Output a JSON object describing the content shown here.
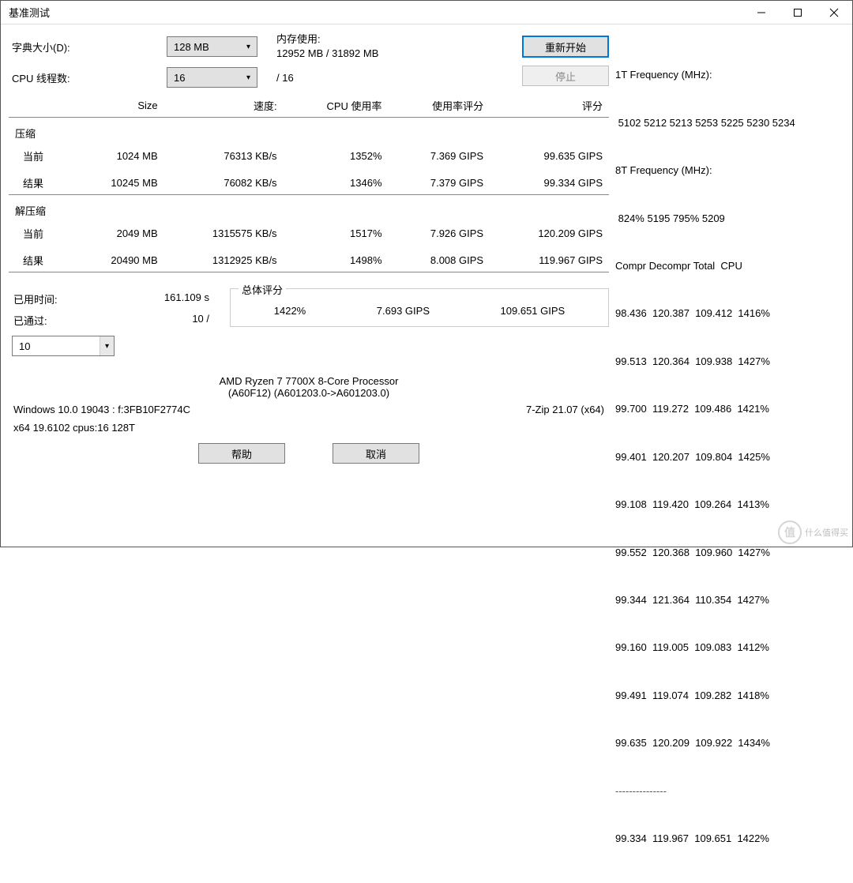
{
  "window": {
    "title": "基准测试"
  },
  "form": {
    "dict_label": "字典大小(D):",
    "dict_value": "128 MB",
    "threads_label": "CPU 线程数:",
    "threads_value": "16",
    "threads_total": "/ 16",
    "mem_label": "内存使用:",
    "mem_value": "12952 MB / 31892 MB"
  },
  "buttons": {
    "restart": "重新开始",
    "stop": "停止",
    "help": "帮助",
    "cancel": "取消"
  },
  "table": {
    "headers": {
      "size": "Size",
      "speed": "速度:",
      "cpu": "CPU 使用率",
      "rpu": "使用率评分",
      "rating": "评分"
    },
    "compress": {
      "title": "压缩",
      "current_label": "当前",
      "current": {
        "size": "1024 MB",
        "speed": "76313 KB/s",
        "cpu": "1352%",
        "rpu": "7.369 GIPS",
        "rating": "99.635 GIPS"
      },
      "result_label": "结果",
      "result": {
        "size": "10245 MB",
        "speed": "76082 KB/s",
        "cpu": "1346%",
        "rpu": "7.379 GIPS",
        "rating": "99.334 GIPS"
      }
    },
    "decompress": {
      "title": "解压缩",
      "current_label": "当前",
      "current": {
        "size": "2049 MB",
        "speed": "1315575 KB/s",
        "cpu": "1517%",
        "rpu": "7.926 GIPS",
        "rating": "120.209 GIPS"
      },
      "result_label": "结果",
      "result": {
        "size": "20490 MB",
        "speed": "1312925 KB/s",
        "cpu": "1498%",
        "rpu": "8.008 GIPS",
        "rating": "119.967 GIPS"
      }
    }
  },
  "status": {
    "elapsed_label": "已用时间:",
    "elapsed": "161.109 s",
    "passes_label": "已通过:",
    "passes": "10 /",
    "passes_select": "10"
  },
  "overall": {
    "title": "总体评分",
    "cpu": "1422%",
    "rpu": "7.693 GIPS",
    "rating": "109.651 GIPS"
  },
  "cpu_info": {
    "line1": "AMD Ryzen 7 7700X 8-Core Processor",
    "line2": "(A60F12) (A601203.0->A601203.0)"
  },
  "sys": {
    "os": "Windows 10.0 19043 :  f:3FB10F2774C",
    "app": "7-Zip 21.07 (x64)",
    "arch": "x64 19.6102 cpus:16 128T"
  },
  "side": {
    "freq1t_label": "1T Frequency (MHz):",
    "freq1t": " 5102 5212 5213 5253 5225 5230 5234",
    "freq8t_label": "8T Frequency (MHz):",
    "freq8t": " 824% 5195 795% 5209",
    "header": "Compr Decompr Total  CPU",
    "rows": [
      "98.436  120.387  109.412  1416%",
      "99.513  120.364  109.938  1427%",
      "99.700  119.272  109.486  1421%",
      "99.401  120.207  109.804  1425%",
      "99.108  119.420  109.264  1413%",
      "99.552  120.368  109.960  1427%",
      "99.344  121.364  110.354  1427%",
      "99.160  119.005  109.083  1412%",
      "99.491  119.074  109.282  1418%",
      "99.635  120.209  109.922  1434%"
    ],
    "divider": "---------------",
    "total": "99.334  119.967  109.651  1422%"
  },
  "watermark": "什么值得买"
}
